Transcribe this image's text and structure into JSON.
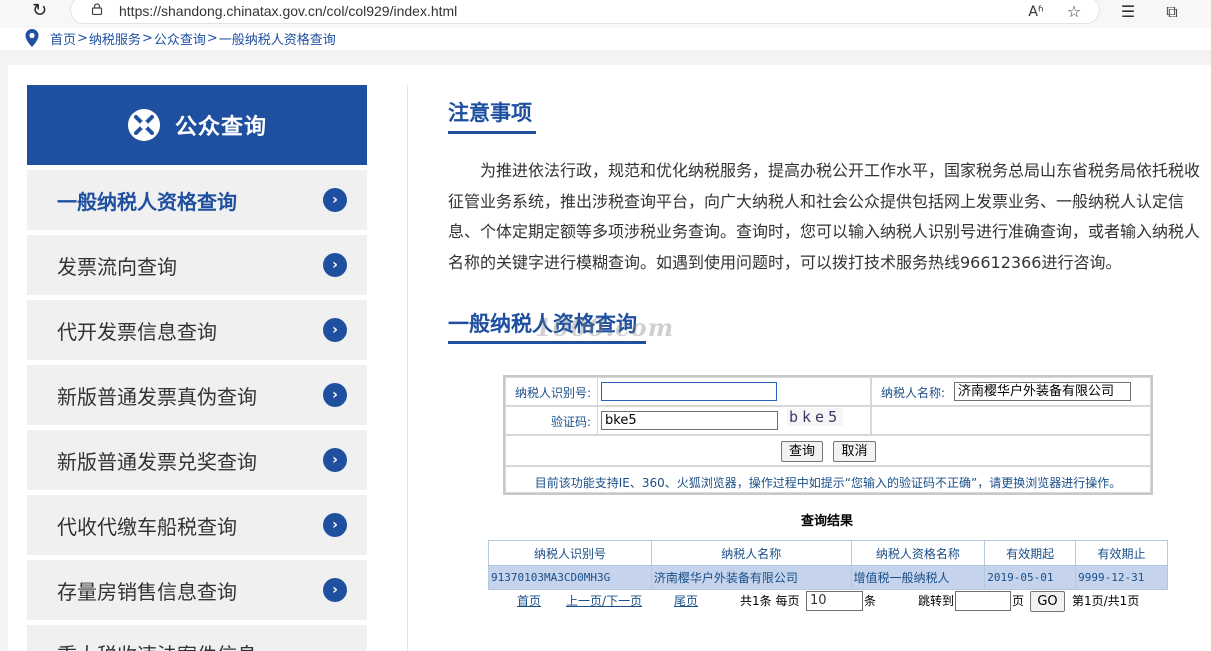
{
  "browser": {
    "url": "https://shandong.chinatax.gov.cn/col/col929/index.html",
    "reload_icon": "reload-icon",
    "toolbar_icons": [
      "read-aloud-icon",
      "favorite-star-icon",
      "favorites-list-icon",
      "collections-icon"
    ]
  },
  "breadcrumb": {
    "items": [
      "首页",
      "纳税服务",
      "公众查询",
      "一般纳税人资格查询"
    ],
    "sep": ">"
  },
  "sidebar": {
    "title": "公众查询",
    "items": [
      {
        "label": "一般纳税人资格查询",
        "active": true
      },
      {
        "label": "发票流向查询"
      },
      {
        "label": "代开发票信息查询"
      },
      {
        "label": "新版普通发票真伪查询"
      },
      {
        "label": "新版普通发票兑奖查询"
      },
      {
        "label": "代收代缴车船税查询"
      },
      {
        "label": "存量房销售信息查询"
      },
      {
        "label": "重大税收违法案件信息"
      }
    ]
  },
  "notice": {
    "title": "注意事项",
    "body": "为推进依法行政，规范和优化纳税服务，提高办税公开工作水平，国家税务总局山东省税务局依托税收征管业务系统，推出涉税查询平台，向广大纳税人和社会公众提供包括网上发票业务、一般纳税人认定信息、个体定期定额等多项涉税业务查询。查询时，您可以输入纳税人识别号进行准确查询，或者输入纳税人名称的关键字进行模糊查询。如遇到使用问题时，可以拨打技术服务热线96612366进行咨询。"
  },
  "query": {
    "title": "一般纳税人资格查询",
    "watermark": "1000.com",
    "id_label": "纳税人识别号:",
    "id_value": "",
    "name_label": "纳税人名称:",
    "name_value": "济南樱华户外装备有限公司",
    "captcha_label": "验证码:",
    "captcha_value": "bke5",
    "captcha_image": "bke5",
    "search_btn": "查询",
    "cancel_btn": "取消",
    "hint": "目前该功能支持IE、360、火狐浏览器，操作过程中如提示“您输入的验证码不正确”，请更换浏览器进行操作。"
  },
  "result": {
    "title": "查询结果",
    "columns": [
      "纳税人识别号",
      "纳税人名称",
      "纳税人资格名称",
      "有效期起",
      "有效期止"
    ],
    "rows": [
      [
        "91370103MA3CD0MH3G",
        "济南樱华户外装备有限公司",
        "增值税一般纳税人",
        "2019-05-01",
        "9999-12-31"
      ]
    ]
  },
  "pager": {
    "first": "首页",
    "prev": "上一页",
    "slash": "/",
    "next": "下一页",
    "last": "尾页",
    "total_text": "共1条 每页",
    "page_size": "10",
    "per_unit": "条",
    "jump_label": "跳转到",
    "jump_value": "",
    "page_unit": "页",
    "go_btn": "GO",
    "status": "第1页/共1页"
  }
}
